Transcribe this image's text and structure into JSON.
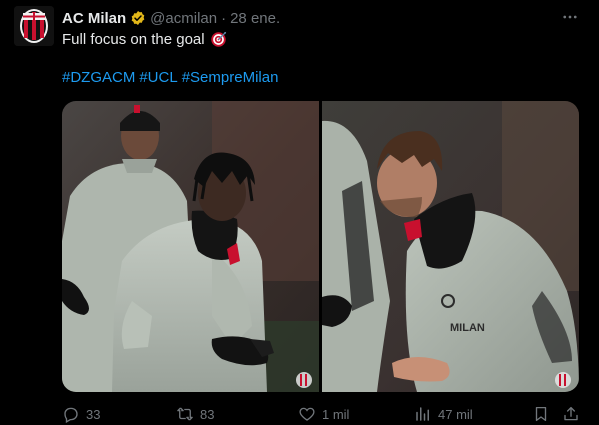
{
  "tweet": {
    "display_name": "AC Milan",
    "handle": "@acmilan",
    "separator": "·",
    "date": "28 ene.",
    "text": "Full focus on the goal",
    "text_emoji": "direct-hit-target-icon",
    "hashtags": [
      "#DZGACM",
      "#UCL",
      "#SempreMilan"
    ],
    "more_icon": "more-horizontal-icon"
  },
  "media": {
    "photos": [
      {
        "subject": "training-photo-1"
      },
      {
        "subject": "training-photo-2"
      }
    ],
    "shirt_text": "MILAN"
  },
  "actions": {
    "replies": "33",
    "retweets": "83",
    "likes": "1 mil",
    "views": "47 mil"
  },
  "colors": {
    "background": "#000000",
    "text": "#e7e9ea",
    "muted": "#71767b",
    "link": "#1d9bf0",
    "verified": "#e2b719",
    "milan_red": "#c8102e"
  }
}
